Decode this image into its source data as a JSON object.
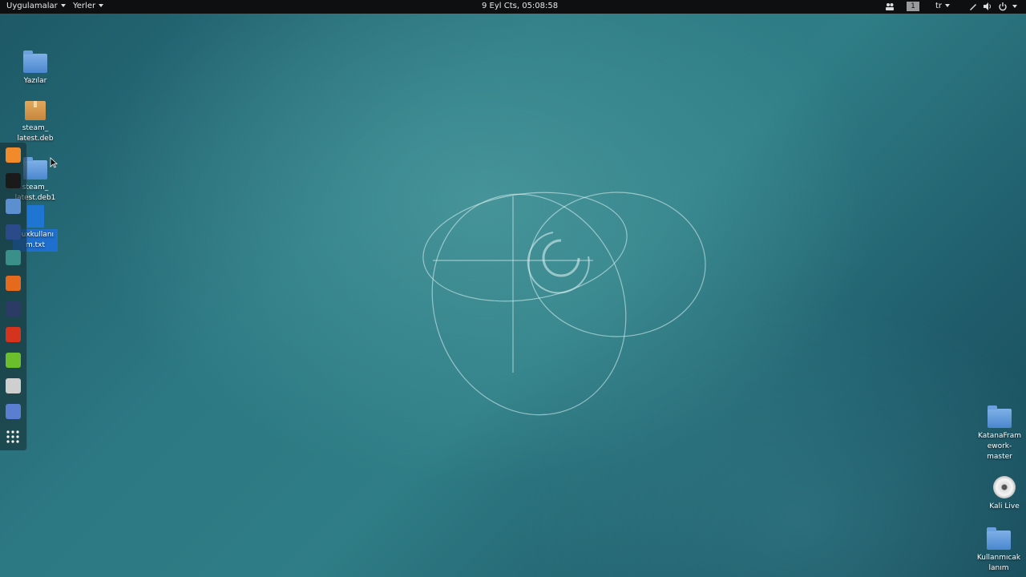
{
  "topbar": {
    "apps_menu": "Uygulamalar",
    "places_menu": "Yerler",
    "clock": "9 Eyl Cts, 05:08:58",
    "workspace": "1",
    "keyboard_layout": "tr",
    "tray_icons": [
      "people-icon",
      "pen-icon",
      "volume-icon",
      "power-icon"
    ]
  },
  "desktop": {
    "left_icons": [
      {
        "label": "Yazılar",
        "icon": "folder-icon"
      },
      {
        "label": "steam_ latest.deb",
        "icon": "package-icon"
      },
      {
        "label": "steam_ latest.deb1",
        "icon": "folder-icon"
      },
      {
        "label": "nuxkullanı m.txt",
        "icon": "text-file-icon"
      }
    ],
    "right_icons": [
      {
        "label": "KatanaFram ework- master",
        "icon": "folder-icon"
      },
      {
        "label": "Kali Live",
        "icon": "disc-icon"
      },
      {
        "label": "Kullanmıcak lanım",
        "icon": "folder-icon"
      }
    ]
  },
  "dock": {
    "apps": [
      "firefox-icon",
      "terminal-icon",
      "files-icon",
      "metasploit-icon",
      "armitage-icon",
      "burpsuite-icon",
      "cutycapt-icon",
      "faraday-icon",
      "leafpad-icon",
      "screenshot-icon",
      "text-editor-icon",
      "show-apps-icon"
    ],
    "colors": [
      "#f08a2a",
      "#1a1a1a",
      "#5b8fd0",
      "#2a4a8a",
      "#3b8f8a",
      "#e66a1e",
      "#2b3b66",
      "#d6331f",
      "#6cbf2c",
      "#cfcfcf",
      "#5a7fd0",
      "#ffffff"
    ]
  }
}
